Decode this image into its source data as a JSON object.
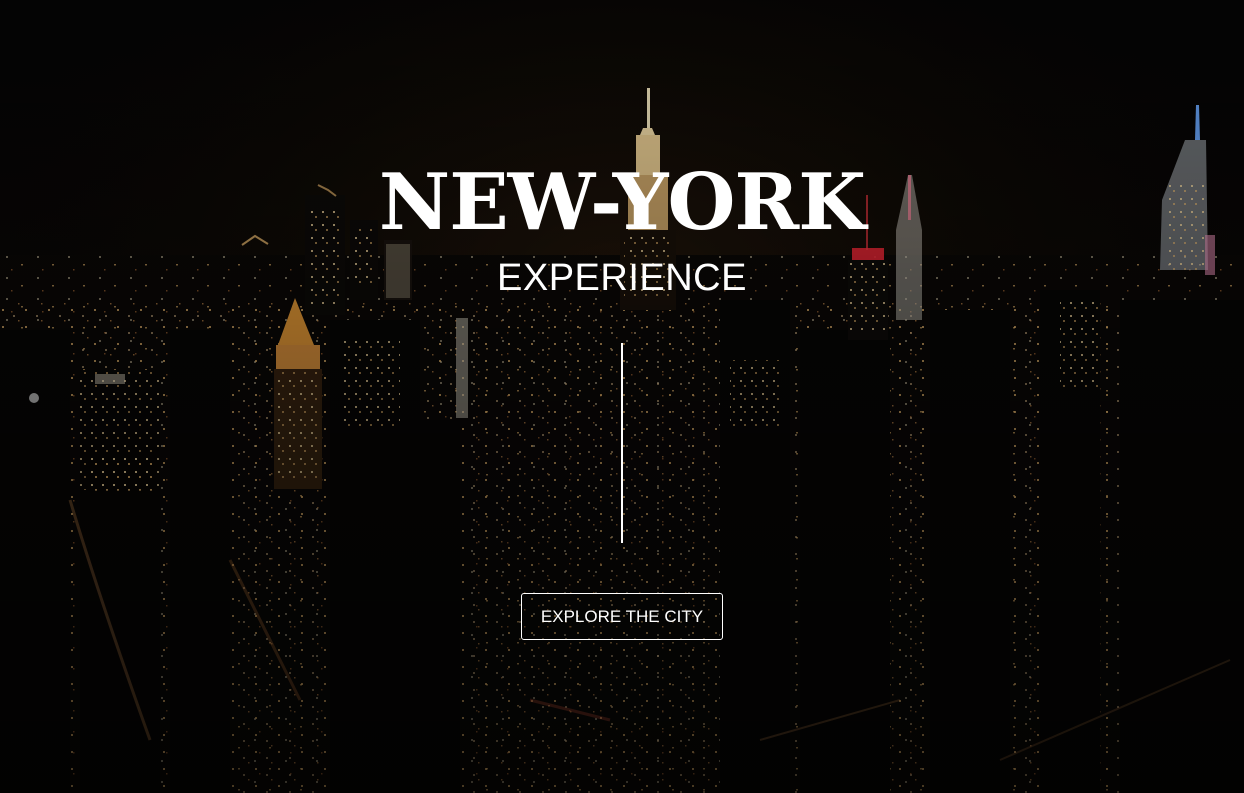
{
  "hero": {
    "title": "NEW-YORK",
    "subtitle": "EXPERIENCE",
    "cta_label": "EXPLORE THE CITY",
    "background": "night-city-skyline-aerial-photo"
  },
  "colors": {
    "text": "#ffffff",
    "sky": "#050505",
    "window_light": "#ffc978",
    "spire_light": "#fff2c8",
    "accent_blue": "#6aa8ff",
    "accent_red": "#ff2a3a"
  }
}
